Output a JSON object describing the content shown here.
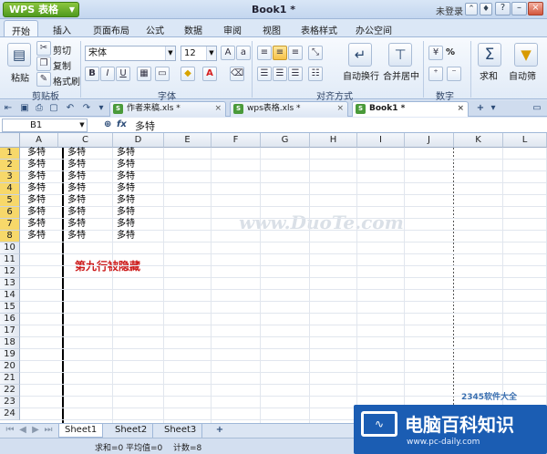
{
  "app": {
    "menu_button": "WPS 表格",
    "window_title": "Book1 *",
    "login": "未登录"
  },
  "menu": [
    "开始",
    "插入",
    "页面布局",
    "公式",
    "数据",
    "审阅",
    "视图",
    "表格样式",
    "办公空间"
  ],
  "ribbon": {
    "paste": "粘贴",
    "cut": "剪切",
    "copy": "复制",
    "format_painter": "格式刷",
    "font_name": "宋体",
    "font_size": "12",
    "bold": "B",
    "italic": "I",
    "underline": "U",
    "wrap": "自动换行",
    "merge": "合并居中",
    "percent": "%",
    "sum": "求和",
    "filter": "自动筛",
    "groups": {
      "clipboard": "剪贴板",
      "font": "字体",
      "align": "对齐方式",
      "number": "数字"
    }
  },
  "doc_tabs": [
    {
      "name": "作者来稿.xls *"
    },
    {
      "name": "wps表格.xls *"
    },
    {
      "name": "Book1 *"
    }
  ],
  "formula": {
    "name_box": "B1",
    "fx": "fx",
    "content": "多特"
  },
  "columns": [
    "A",
    "C",
    "D",
    "E",
    "F",
    "G",
    "H",
    "I",
    "J",
    "K",
    "L"
  ],
  "rows": [
    "1",
    "2",
    "3",
    "4",
    "5",
    "6",
    "7",
    "8",
    "10",
    "11",
    "12",
    "13",
    "14",
    "15",
    "16",
    "17",
    "18",
    "19",
    "20",
    "21",
    "22",
    "23",
    "24"
  ],
  "cell_text": "多特",
  "cells": [
    [
      "多特",
      "多特",
      "多特"
    ],
    [
      "多特",
      "多特",
      "多特"
    ],
    [
      "多特",
      "多特",
      "多特"
    ],
    [
      "多特",
      "多特",
      "多特"
    ],
    [
      "多特",
      "多特",
      "多特"
    ],
    [
      "多特",
      "多特",
      "多特"
    ],
    [
      "多特",
      "多特",
      "多特"
    ],
    [
      "多特",
      "多特",
      "多特"
    ]
  ],
  "annotation": "第九行被隐藏",
  "watermark": "www.DuoTe.com",
  "sheets": [
    "Sheet1",
    "Sheet2",
    "Sheet3"
  ],
  "status": {
    "sum": "求和=0",
    "avg": "平均值=0",
    "count": "计数=8"
  },
  "logo": {
    "title": "电脑百科知识",
    "url": "www.pc-daily.com",
    "badge": "2345软件大全"
  },
  "colors": {
    "accent": "#1b5db3",
    "note": "#cc1a1a"
  }
}
